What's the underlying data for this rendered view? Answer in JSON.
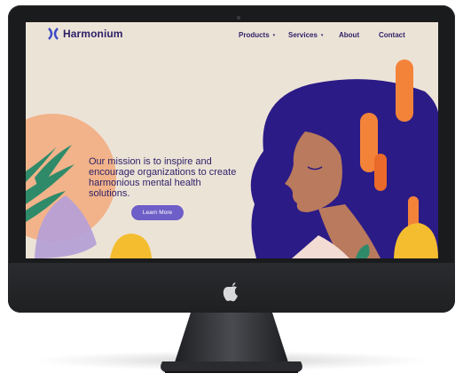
{
  "site": {
    "brand": "Harmonium",
    "nav": {
      "products": "Products",
      "services": "Services",
      "about": "About",
      "contact": "Contact"
    },
    "hero": {
      "mission": "Our mission is to inspire and encourage organizations to create harmonious mental health solutions.",
      "cta": "Learn More"
    }
  },
  "colors": {
    "background": "#ece3d7",
    "brand": "#2c1f66",
    "button": "#6e5ec7",
    "accent_orange": "#f4833a",
    "hair": "#2b1b86",
    "skin": "#b97a5d"
  },
  "icons": {
    "logo": "harmonium-logo-icon",
    "apple": "apple-logo-icon",
    "dropdown": "caret-down-icon"
  }
}
